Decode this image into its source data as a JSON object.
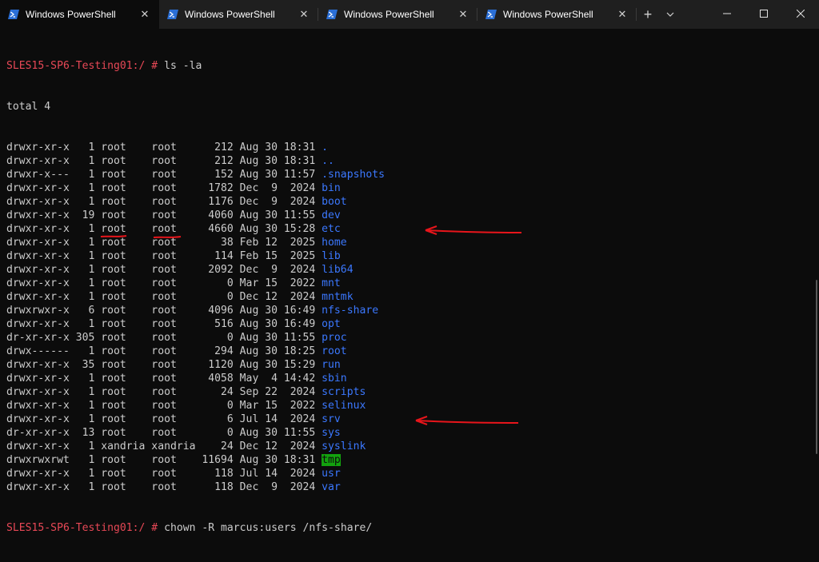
{
  "tabs": [
    {
      "label": "Windows PowerShell",
      "icon": "powershell-icon",
      "active": true
    },
    {
      "label": "Windows PowerShell",
      "icon": "powershell-icon",
      "active": false
    },
    {
      "label": "Windows PowerShell",
      "icon": "powershell-icon",
      "active": false
    },
    {
      "label": "Windows PowerShell",
      "icon": "powershell-icon",
      "active": false
    }
  ],
  "titlebar": {
    "new_tab": "+",
    "dropdown": "chevron-down-icon",
    "window_controls": [
      "minimize-icon",
      "maximize-icon",
      "close-icon"
    ]
  },
  "terminal": {
    "prompt": "SLES15-SP6-Testing01:/ #",
    "command1": " ls -la",
    "total": "total 4",
    "rows": [
      {
        "meta": "drwxr-xr-x   1 root    root      212 Aug 30 18:31 ",
        "name": "."
      },
      {
        "meta": "drwxr-xr-x   1 root    root      212 Aug 30 18:31 ",
        "name": ".."
      },
      {
        "meta": "drwxr-x---   1 root    root      152 Aug 30 11:57 ",
        "name": ".snapshots"
      },
      {
        "meta": "drwxr-xr-x   1 root    root     1782 Dec  9  2024 ",
        "name": "bin"
      },
      {
        "meta": "drwxr-xr-x   1 root    root     1176 Dec  9  2024 ",
        "name": "boot"
      },
      {
        "meta": "drwxr-xr-x  19 root    root     4060 Aug 30 11:55 ",
        "name": "dev"
      },
      {
        "meta": "drwxr-xr-x   1 root    root     4660 Aug 30 15:28 ",
        "name": "etc"
      },
      {
        "meta": "drwxr-xr-x   1 root    root       38 Feb 12  2025 ",
        "name": "home"
      },
      {
        "meta": "drwxr-xr-x   1 root    root      114 Feb 15  2025 ",
        "name": "lib"
      },
      {
        "meta": "drwxr-xr-x   1 root    root     2092 Dec  9  2024 ",
        "name": "lib64"
      },
      {
        "meta": "drwxr-xr-x   1 root    root        0 Mar 15  2022 ",
        "name": "mnt"
      },
      {
        "meta": "drwxr-xr-x   1 root    root        0 Dec 12  2024 ",
        "name": "mntmk"
      },
      {
        "meta": "drwxrwxr-x   6 root    root     4096 Aug 30 16:49 ",
        "name": "nfs-share"
      },
      {
        "meta": "drwxr-xr-x   1 root    root      516 Aug 30 16:49 ",
        "name": "opt"
      },
      {
        "meta": "dr-xr-xr-x 305 root    root        0 Aug 30 11:55 ",
        "name": "proc"
      },
      {
        "meta": "drwx------   1 root    root      294 Aug 30 18:25 ",
        "name": "root"
      },
      {
        "meta": "drwxr-xr-x  35 root    root     1120 Aug 30 15:29 ",
        "name": "run"
      },
      {
        "meta": "drwxr-xr-x   1 root    root     4058 May  4 14:42 ",
        "name": "sbin"
      },
      {
        "meta": "drwxr-xr-x   1 root    root       24 Sep 22  2024 ",
        "name": "scripts"
      },
      {
        "meta": "drwxr-xr-x   1 root    root        0 Mar 15  2022 ",
        "name": "selinux"
      },
      {
        "meta": "drwxr-xr-x   1 root    root        6 Jul 14  2024 ",
        "name": "srv"
      },
      {
        "meta": "dr-xr-xr-x  13 root    root        0 Aug 30 11:55 ",
        "name": "sys"
      },
      {
        "meta": "drwxr-xr-x   1 xandria xandria    24 Dec 12  2024 ",
        "name": "syslink"
      },
      {
        "meta": "drwxrwxrwt   1 root    root    11694 Aug 30 18:31 ",
        "name": "tmp",
        "highlight": true
      },
      {
        "meta": "drwxr-xr-x   1 root    root      118 Jul 14  2024 ",
        "name": "usr"
      },
      {
        "meta": "drwxr-xr-x   1 root    root      118 Dec  9  2024 ",
        "name": "var"
      }
    ],
    "command2": " chown -R marcus:users /nfs-share/"
  },
  "colors": {
    "background": "#0c0c0c",
    "titlebar": "#1f1f1f",
    "text": "#cccccc",
    "prompt": "#e74856",
    "directory": "#3b78ff",
    "highlight": "#13a10e",
    "annotation": "#e8151b"
  }
}
